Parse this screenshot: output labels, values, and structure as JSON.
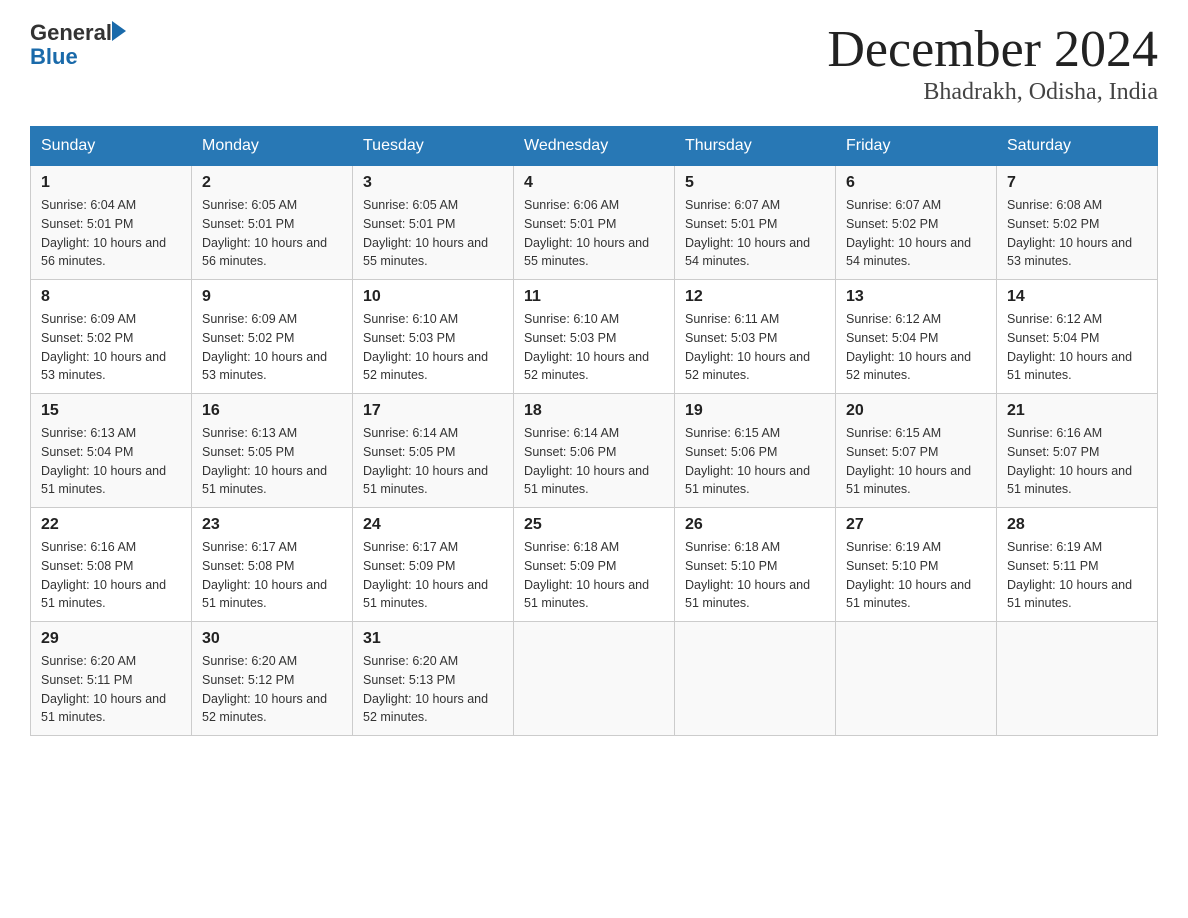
{
  "logo": {
    "text_general": "General",
    "text_blue": "Blue"
  },
  "header": {
    "month_title": "December 2024",
    "location": "Bhadrakh, Odisha, India"
  },
  "weekdays": [
    "Sunday",
    "Monday",
    "Tuesday",
    "Wednesday",
    "Thursday",
    "Friday",
    "Saturday"
  ],
  "weeks": [
    [
      {
        "day": "1",
        "sunrise": "6:04 AM",
        "sunset": "5:01 PM",
        "daylight": "10 hours and 56 minutes."
      },
      {
        "day": "2",
        "sunrise": "6:05 AM",
        "sunset": "5:01 PM",
        "daylight": "10 hours and 56 minutes."
      },
      {
        "day": "3",
        "sunrise": "6:05 AM",
        "sunset": "5:01 PM",
        "daylight": "10 hours and 55 minutes."
      },
      {
        "day": "4",
        "sunrise": "6:06 AM",
        "sunset": "5:01 PM",
        "daylight": "10 hours and 55 minutes."
      },
      {
        "day": "5",
        "sunrise": "6:07 AM",
        "sunset": "5:01 PM",
        "daylight": "10 hours and 54 minutes."
      },
      {
        "day": "6",
        "sunrise": "6:07 AM",
        "sunset": "5:02 PM",
        "daylight": "10 hours and 54 minutes."
      },
      {
        "day": "7",
        "sunrise": "6:08 AM",
        "sunset": "5:02 PM",
        "daylight": "10 hours and 53 minutes."
      }
    ],
    [
      {
        "day": "8",
        "sunrise": "6:09 AM",
        "sunset": "5:02 PM",
        "daylight": "10 hours and 53 minutes."
      },
      {
        "day": "9",
        "sunrise": "6:09 AM",
        "sunset": "5:02 PM",
        "daylight": "10 hours and 53 minutes."
      },
      {
        "day": "10",
        "sunrise": "6:10 AM",
        "sunset": "5:03 PM",
        "daylight": "10 hours and 52 minutes."
      },
      {
        "day": "11",
        "sunrise": "6:10 AM",
        "sunset": "5:03 PM",
        "daylight": "10 hours and 52 minutes."
      },
      {
        "day": "12",
        "sunrise": "6:11 AM",
        "sunset": "5:03 PM",
        "daylight": "10 hours and 52 minutes."
      },
      {
        "day": "13",
        "sunrise": "6:12 AM",
        "sunset": "5:04 PM",
        "daylight": "10 hours and 52 minutes."
      },
      {
        "day": "14",
        "sunrise": "6:12 AM",
        "sunset": "5:04 PM",
        "daylight": "10 hours and 51 minutes."
      }
    ],
    [
      {
        "day": "15",
        "sunrise": "6:13 AM",
        "sunset": "5:04 PM",
        "daylight": "10 hours and 51 minutes."
      },
      {
        "day": "16",
        "sunrise": "6:13 AM",
        "sunset": "5:05 PM",
        "daylight": "10 hours and 51 minutes."
      },
      {
        "day": "17",
        "sunrise": "6:14 AM",
        "sunset": "5:05 PM",
        "daylight": "10 hours and 51 minutes."
      },
      {
        "day": "18",
        "sunrise": "6:14 AM",
        "sunset": "5:06 PM",
        "daylight": "10 hours and 51 minutes."
      },
      {
        "day": "19",
        "sunrise": "6:15 AM",
        "sunset": "5:06 PM",
        "daylight": "10 hours and 51 minutes."
      },
      {
        "day": "20",
        "sunrise": "6:15 AM",
        "sunset": "5:07 PM",
        "daylight": "10 hours and 51 minutes."
      },
      {
        "day": "21",
        "sunrise": "6:16 AM",
        "sunset": "5:07 PM",
        "daylight": "10 hours and 51 minutes."
      }
    ],
    [
      {
        "day": "22",
        "sunrise": "6:16 AM",
        "sunset": "5:08 PM",
        "daylight": "10 hours and 51 minutes."
      },
      {
        "day": "23",
        "sunrise": "6:17 AM",
        "sunset": "5:08 PM",
        "daylight": "10 hours and 51 minutes."
      },
      {
        "day": "24",
        "sunrise": "6:17 AM",
        "sunset": "5:09 PM",
        "daylight": "10 hours and 51 minutes."
      },
      {
        "day": "25",
        "sunrise": "6:18 AM",
        "sunset": "5:09 PM",
        "daylight": "10 hours and 51 minutes."
      },
      {
        "day": "26",
        "sunrise": "6:18 AM",
        "sunset": "5:10 PM",
        "daylight": "10 hours and 51 minutes."
      },
      {
        "day": "27",
        "sunrise": "6:19 AM",
        "sunset": "5:10 PM",
        "daylight": "10 hours and 51 minutes."
      },
      {
        "day": "28",
        "sunrise": "6:19 AM",
        "sunset": "5:11 PM",
        "daylight": "10 hours and 51 minutes."
      }
    ],
    [
      {
        "day": "29",
        "sunrise": "6:20 AM",
        "sunset": "5:11 PM",
        "daylight": "10 hours and 51 minutes."
      },
      {
        "day": "30",
        "sunrise": "6:20 AM",
        "sunset": "5:12 PM",
        "daylight": "10 hours and 52 minutes."
      },
      {
        "day": "31",
        "sunrise": "6:20 AM",
        "sunset": "5:13 PM",
        "daylight": "10 hours and 52 minutes."
      },
      null,
      null,
      null,
      null
    ]
  ]
}
